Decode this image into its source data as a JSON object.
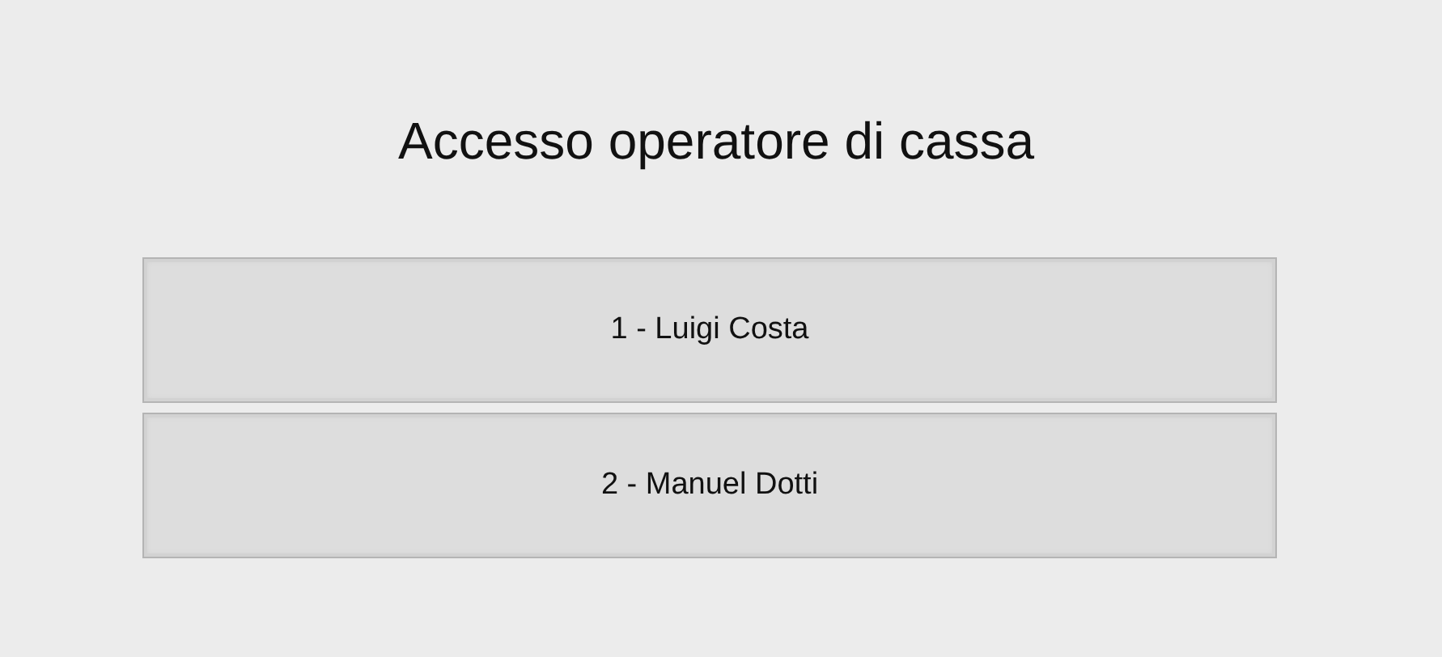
{
  "title": "Accesso operatore di cassa",
  "operators": [
    {
      "label": "1 - Luigi Costa"
    },
    {
      "label": "2 - Manuel Dotti"
    }
  ]
}
